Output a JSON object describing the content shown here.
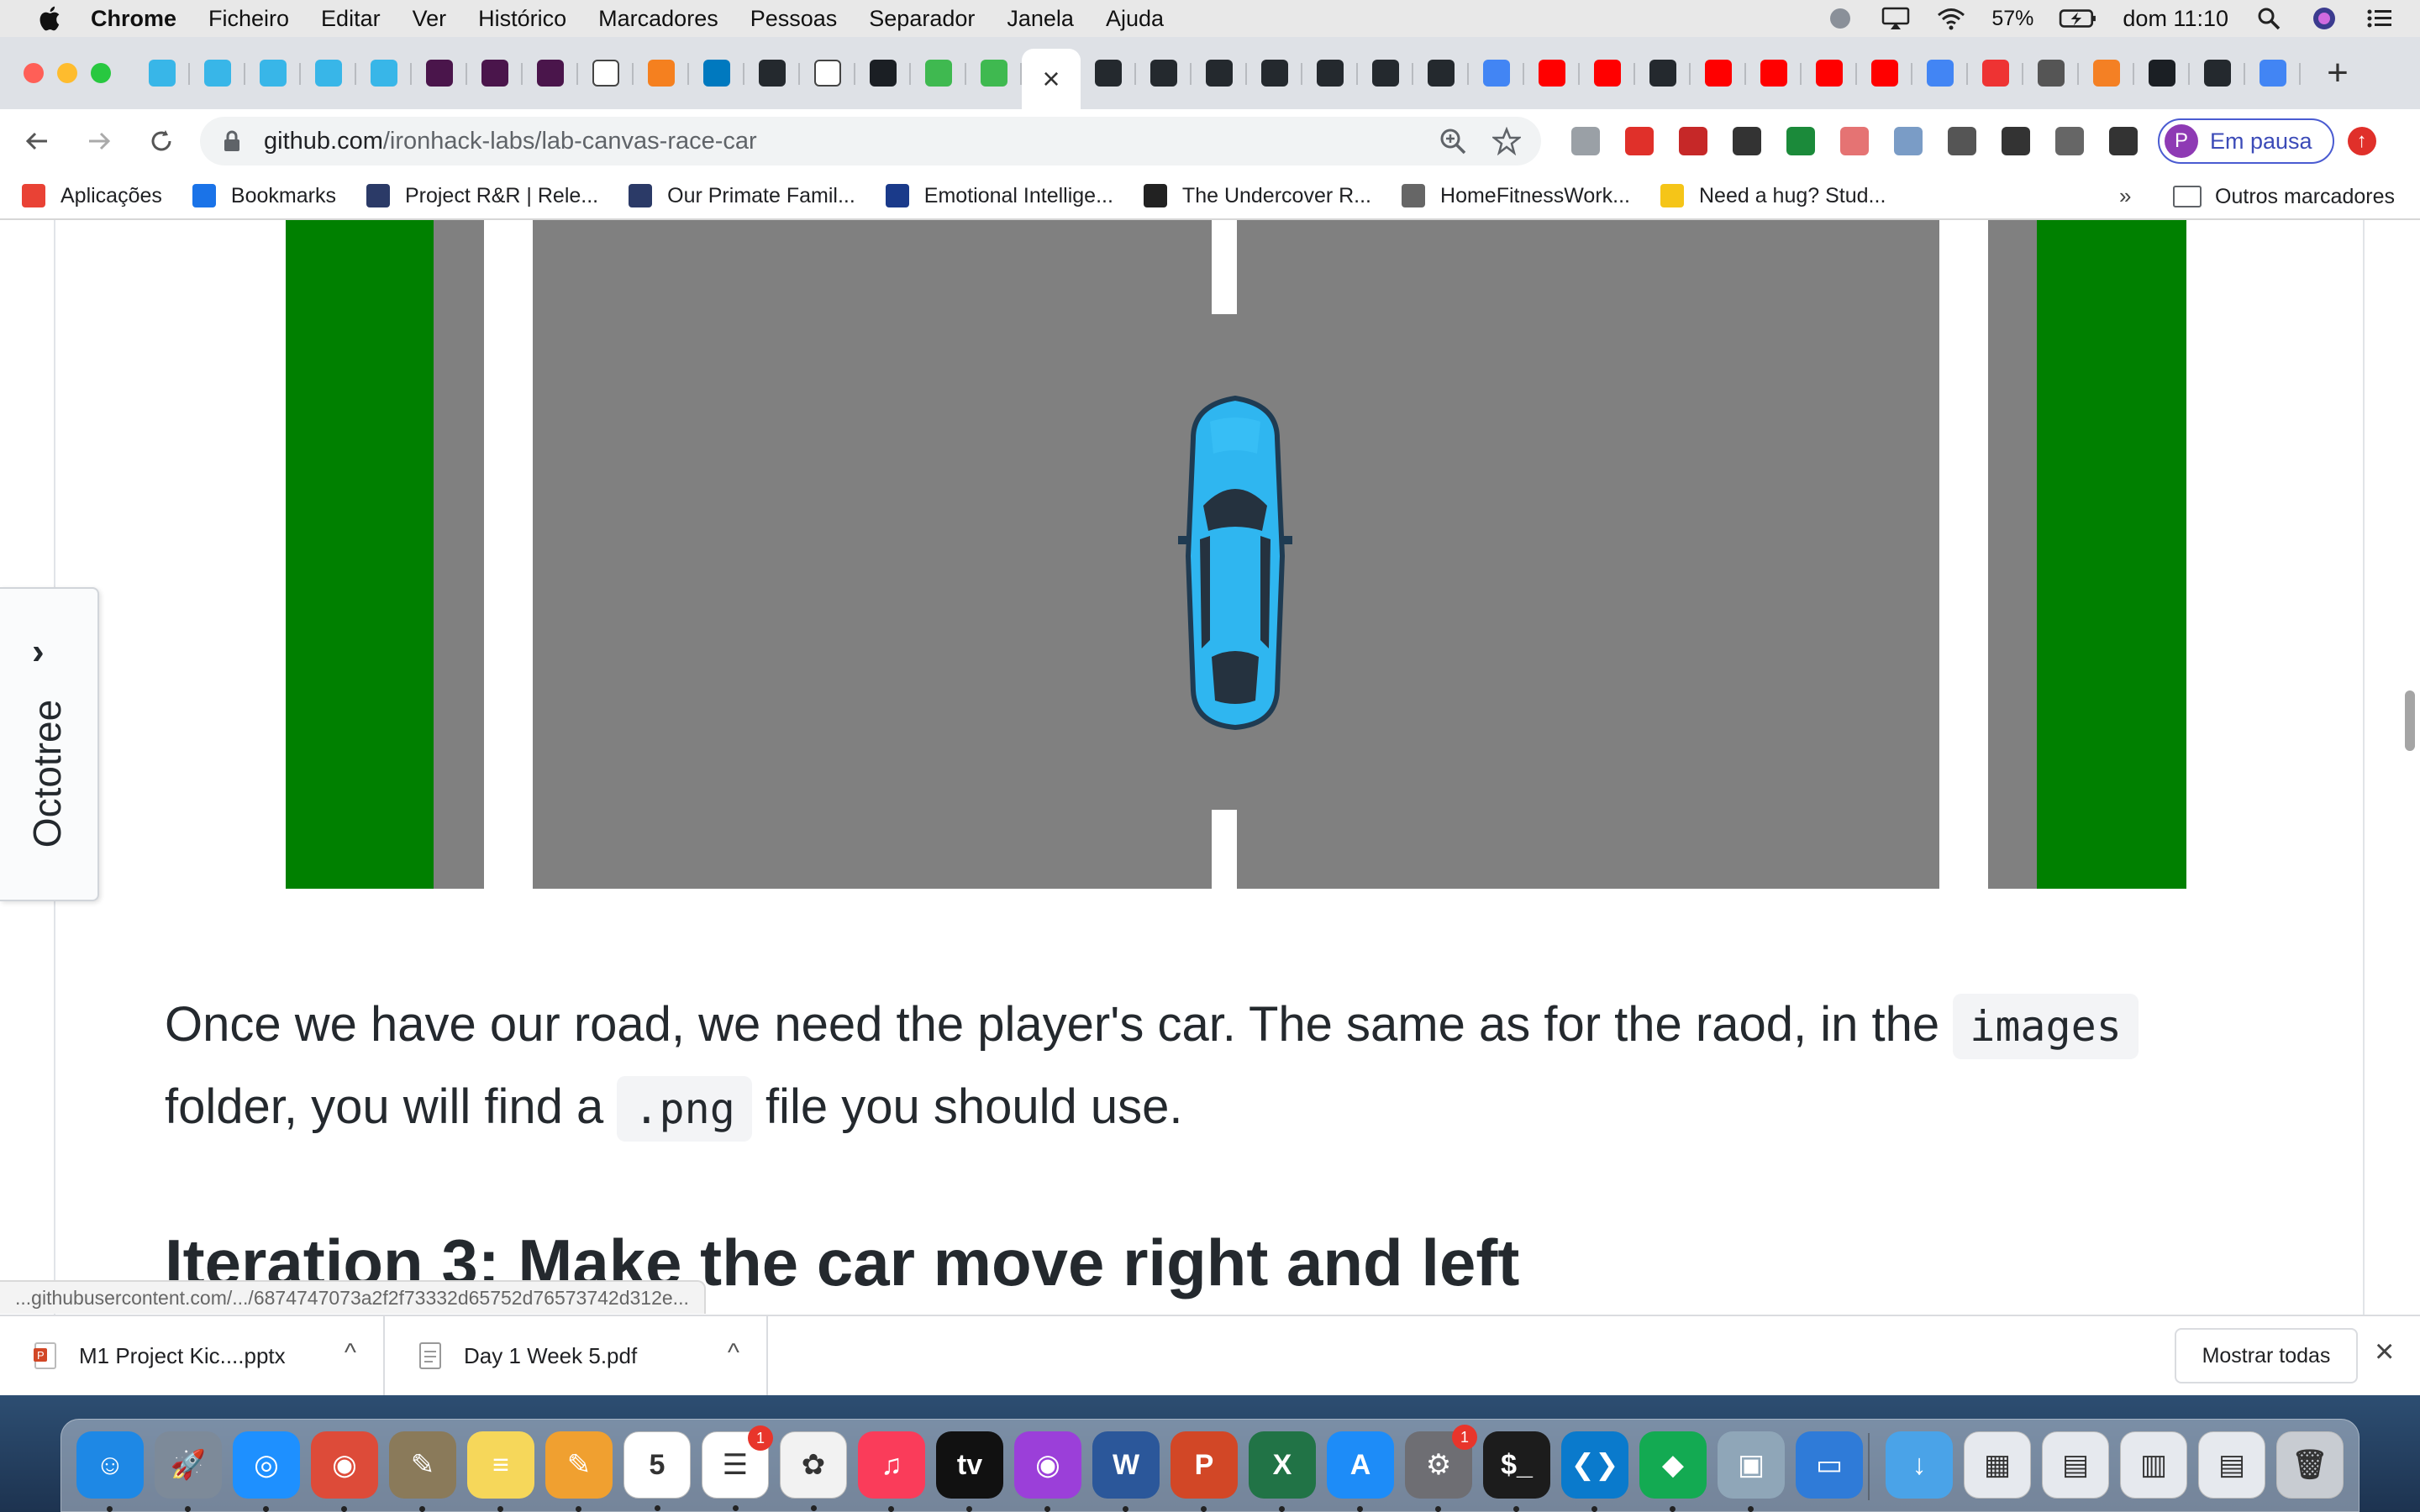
{
  "menubar": {
    "app_name": "Chrome",
    "items": [
      "Ficheiro",
      "Editar",
      "Ver",
      "Histórico",
      "Marcadores",
      "Pessoas",
      "Separador",
      "Janela",
      "Ajuda"
    ],
    "battery": "57%",
    "clock": "dom 11:10"
  },
  "tabs": {
    "favicon_colors": [
      "#38b6e8",
      "#38b6e8",
      "#38b6e8",
      "#38b6e8",
      "#38b6e8",
      "#4a154b",
      "#4a154b",
      "#4a154b",
      "#ffffff",
      "#f5801f",
      "#0079bf",
      "#24292e",
      "#ffffff",
      "#1b1f24",
      "#3fb950",
      "#3fb950"
    ],
    "active_close": "×",
    "after_colors": [
      "#24292e",
      "#24292e",
      "#24292e",
      "#24292e",
      "#24292e",
      "#24292e",
      "#24292e",
      "#4285f4",
      "#ff0000",
      "#ff0000",
      "#24292e",
      "#ff0000",
      "#ff0000",
      "#ff0000",
      "#ff0000",
      "#4285f4",
      "#e33",
      "#555",
      "#f48024",
      "#1b1f24",
      "#24292e",
      "#4285f4"
    ],
    "new_tab": "+"
  },
  "toolbar": {
    "url_host": "github.com",
    "url_path": "/ironhack-labs/lab-canvas-race-car",
    "extension_colors": [
      "#9aa0a6",
      "#e0302a",
      "#c62828",
      "#333333",
      "#1b8a3a",
      "#e57373",
      "#7a9cc6",
      "#555555",
      "#333333",
      "#666666",
      "#333333"
    ],
    "profile_initial": "P",
    "profile_label": "Em pausa"
  },
  "bookmarks": {
    "items": [
      {
        "label": "Aplicações",
        "icon": "apps-grid-icon",
        "color": "#e94235"
      },
      {
        "label": "Bookmarks",
        "icon": "star-icon",
        "color": "#1a73e8"
      },
      {
        "label": "Project R&R | Rele...",
        "icon": "grid-icon",
        "color": "#2b3a67"
      },
      {
        "label": "Our Primate Famil...",
        "icon": "grid-icon",
        "color": "#2b3a67"
      },
      {
        "label": "Emotional Intellige...",
        "icon": "hbr-icon",
        "color": "#1a3a8a"
      },
      {
        "label": "The Undercover R...",
        "icon": "g-icon",
        "color": "#222222"
      },
      {
        "label": "HomeFitnessWork...",
        "icon": "fitness-icon",
        "color": "#666666"
      },
      {
        "label": "Need a hug? Stud...",
        "icon": "m-icon",
        "color": "#f5c518"
      }
    ],
    "more": "»",
    "others": "Outros marcadores"
  },
  "page": {
    "octotree_label": "Octotree",
    "octotree_chevron": "›",
    "para_part1": "Once we have our road, we need the player's car. The same as for the raod, in the ",
    "para_code1": "images",
    "para_part2": " folder, you will find a ",
    "para_code2": ".png",
    "para_part3": " file you should use.",
    "heading": "Iteration 3: Make the car move right and left",
    "road_colors": {
      "grass": "#008000",
      "asphalt": "#808080",
      "lines": "#ffffff",
      "car": "#2fb6f0"
    }
  },
  "status_url": "...githubusercontent.com/.../6874747073a2f2f73332d65752d76573742d312e...",
  "downloads": {
    "items": [
      {
        "name": "M1 Project Kic....pptx",
        "icon_color": "#d24726"
      },
      {
        "name": "Day 1 Week 5.pdf",
        "icon_color": "#9aa0a6"
      }
    ],
    "caret": "^",
    "show_all": "Mostrar todas",
    "close": "×"
  },
  "dock": {
    "apps": [
      {
        "name": "Finder",
        "color": "#1e88e5",
        "glyph": "☺"
      },
      {
        "name": "Launchpad",
        "color": "#7d8a99",
        "glyph": "🚀"
      },
      {
        "name": "Safari",
        "color": "#1e90ff",
        "glyph": "◎"
      },
      {
        "name": "Chrome",
        "color": "#dd4b39",
        "glyph": "◉"
      },
      {
        "name": "Preview",
        "color": "#8a7a5a",
        "glyph": "✎"
      },
      {
        "name": "Notes",
        "color": "#f6d75a",
        "glyph": "≡"
      },
      {
        "name": "Pages",
        "color": "#f0a030",
        "glyph": "✎"
      },
      {
        "name": "Calendar",
        "color": "#ffffff",
        "glyph": "5",
        "dark": true
      },
      {
        "name": "Reminders",
        "color": "#ffffff",
        "glyph": "☰",
        "badge": "1",
        "dark": true
      },
      {
        "name": "Photos",
        "color": "#f2f2f2",
        "glyph": "✿",
        "dark": true
      },
      {
        "name": "Music",
        "color": "#fa3c5a",
        "glyph": "♫"
      },
      {
        "name": "TV",
        "color": "#111111",
        "glyph": "tv"
      },
      {
        "name": "Podcasts",
        "color": "#9b3fd9",
        "glyph": "◉"
      },
      {
        "name": "Word",
        "color": "#2b579a",
        "glyph": "W"
      },
      {
        "name": "PowerPoint",
        "color": "#d24726",
        "glyph": "P"
      },
      {
        "name": "Excel",
        "color": "#217346",
        "glyph": "X"
      },
      {
        "name": "App Store",
        "color": "#1d8cf8",
        "glyph": "A"
      },
      {
        "name": "System Preferences",
        "color": "#6e6e73",
        "glyph": "⚙",
        "badge": "1"
      },
      {
        "name": "Terminal",
        "color": "#1c1c1c",
        "glyph": "$_"
      },
      {
        "name": "VS Code",
        "color": "#0a7acc",
        "glyph": "❮❯"
      },
      {
        "name": "MongoDB",
        "color": "#13aa52",
        "glyph": "◆"
      },
      {
        "name": "Image Capture",
        "color": "#8fa6b8",
        "glyph": "▣"
      },
      {
        "name": "Keynote",
        "color": "#2f7bd8",
        "glyph": "▭"
      },
      {
        "name": "Downloads",
        "color": "#4aa3e8",
        "glyph": "↓"
      },
      {
        "name": "Screenshots",
        "color": "#e6e9ee",
        "glyph": "▦",
        "dark": true
      },
      {
        "name": "Documents",
        "color": "#e6e9ee",
        "glyph": "▤",
        "dark": true
      },
      {
        "name": "Desktop",
        "color": "#e6e9ee",
        "glyph": "▥",
        "dark": true
      },
      {
        "name": "Folder",
        "color": "#e6e9ee",
        "glyph": "▤",
        "dark": true
      },
      {
        "name": "Trash",
        "color": "#c8ccd2",
        "glyph": "🗑",
        "dark": true
      }
    ]
  }
}
